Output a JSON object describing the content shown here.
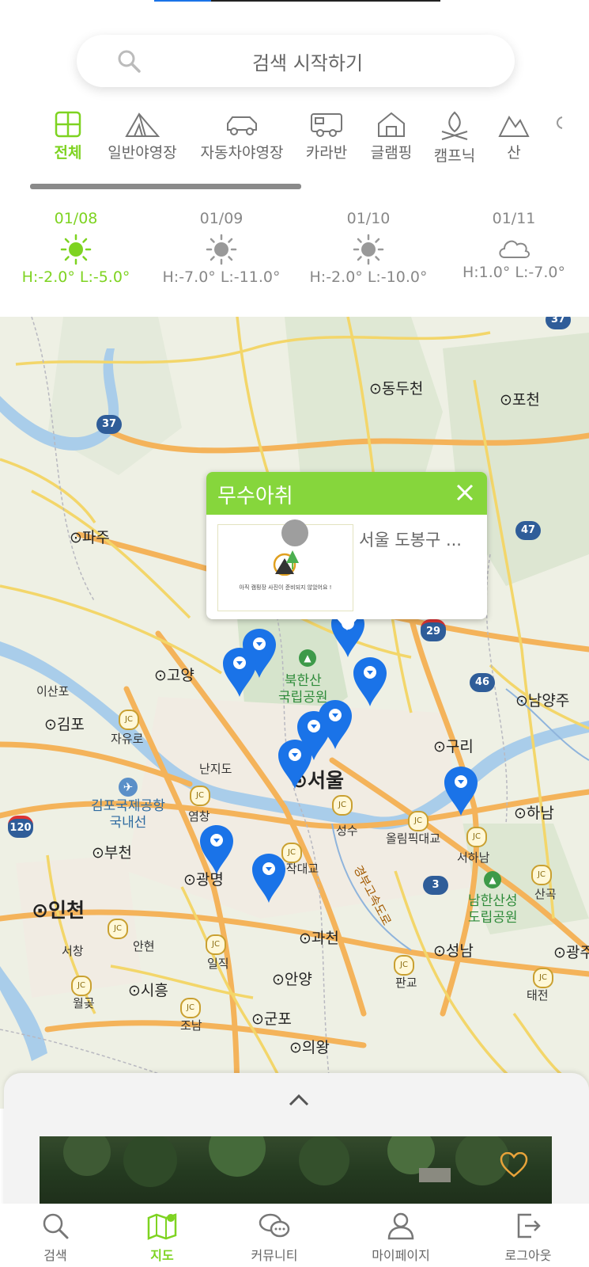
{
  "search": {
    "placeholder": "검색 시작하기"
  },
  "categories": [
    {
      "label": "전체",
      "icon": "grid-icon",
      "active": true
    },
    {
      "label": "일반야영장",
      "icon": "tent-icon"
    },
    {
      "label": "자동차야영장",
      "icon": "car-icon"
    },
    {
      "label": "카라반",
      "icon": "caravan-icon"
    },
    {
      "label": "글램핑",
      "icon": "house-icon"
    },
    {
      "label": "캠프닉",
      "icon": "campfire-icon"
    },
    {
      "label": "산",
      "icon": "mountain-icon"
    }
  ],
  "weather": [
    {
      "date": "01/08",
      "icon": "sun-icon",
      "temp": "H:-2.0° L:-5.0°",
      "today": true
    },
    {
      "date": "01/09",
      "icon": "sun-icon",
      "temp": "H:-7.0° L:-11.0°"
    },
    {
      "date": "01/10",
      "icon": "sun-icon",
      "temp": "H:-2.0° L:-10.0°"
    },
    {
      "date": "01/11",
      "icon": "cloud-icon",
      "temp": "H:1.0° L:-7.0°"
    }
  ],
  "map": {
    "places": {
      "dongducheon": "동두천",
      "pocheon": "포천",
      "paju": "파주",
      "goyang": "고양",
      "bukhansan": "북한산\n국립공원",
      "namyangju": "남양주",
      "gimpo": "김포",
      "isanpo": "이산포",
      "jayuro": "자유로",
      "nanjido": "난지도",
      "seoul": "서울",
      "guri": "구리",
      "gimpo_airport": "김포국제공항\n국내선",
      "yeomchang": "염창",
      "seongsu": "성수",
      "olympic": "올림픽대교",
      "hanam": "하남",
      "bucheon": "부천",
      "gwangmyeong": "광명",
      "dongjak": "동작대교",
      "gyeongbu": "경부고속도로",
      "seohanam": "서하남",
      "namhansanseong": "남한산성\n도립공원",
      "sangok": "산곡",
      "incheon": "인천",
      "seochang": "서창",
      "anhyeon": "안현",
      "ilsik": "일직",
      "gwacheon": "과천",
      "seongnam": "성남",
      "gwangju": "광주",
      "wolgot": "월곶",
      "siheung": "시흥",
      "anyang": "안양",
      "pangyo": "판교",
      "taejeon": "태전",
      "gunpo": "군포",
      "joman": "조남",
      "uiwang": "의왕"
    },
    "shields": {
      "s37a": "37",
      "s37b": "37",
      "s47": "47",
      "s29": "29",
      "s46": "46",
      "s120": "120",
      "s3": "3"
    },
    "jc": "JC"
  },
  "popup": {
    "title": "무수아취",
    "address": "서울 도봉구 ...",
    "thumb_caption": "아직 캠핑장 사진이 준비되지 않았어요 !"
  },
  "bottom_tabs": [
    {
      "label": "검색",
      "icon": "search-icon"
    },
    {
      "label": "지도",
      "icon": "map-icon",
      "active": true
    },
    {
      "label": "커뮤니티",
      "icon": "chat-icon"
    },
    {
      "label": "마이페이지",
      "icon": "person-icon"
    },
    {
      "label": "로그아웃",
      "icon": "logout-icon"
    }
  ],
  "colors": {
    "accent": "#7ed321",
    "pin": "#1a73e8",
    "popup_header": "#86d63c",
    "heart": "#e8a33a"
  }
}
